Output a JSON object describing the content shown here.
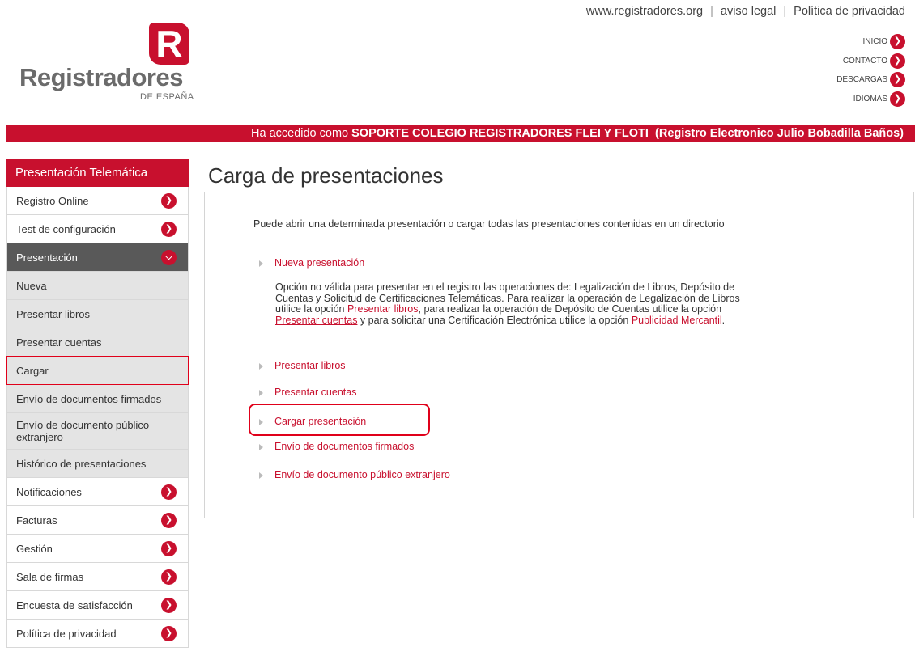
{
  "top_links": [
    "www.registradores.org",
    "aviso legal",
    "Política de privacidad"
  ],
  "logo": {
    "mark": "R",
    "name": "Registradores",
    "sub": "DE ESPAÑA"
  },
  "right_menu": [
    "INICIO",
    "CONTACTO",
    "DESCARGAS",
    "IDIOMAS"
  ],
  "login_bar": {
    "prefix": "Ha accedido como",
    "user": "SOPORTE COLEGIO REGISTRADORES FLEI Y FLOTI",
    "registry": "(Registro Electronico Julio Bobadilla Baños)"
  },
  "sidebar": {
    "header": "Presentación Telemática",
    "items": [
      {
        "label": "Registro Online"
      },
      {
        "label": "Test de configuración"
      },
      {
        "label": "Presentación"
      },
      {
        "label": "Nueva"
      },
      {
        "label": "Presentar libros"
      },
      {
        "label": "Presentar cuentas"
      },
      {
        "label": "Cargar"
      },
      {
        "label": "Envío de documentos firmados"
      },
      {
        "label": "Envío de documento público extranjero"
      },
      {
        "label": "Histórico de presentaciones"
      },
      {
        "label": "Notificaciones"
      },
      {
        "label": "Facturas"
      },
      {
        "label": "Gestión"
      },
      {
        "label": "Sala de firmas"
      },
      {
        "label": "Encuesta de satisfacción"
      },
      {
        "label": "Política de privacidad"
      }
    ]
  },
  "main": {
    "title": "Carga de presentaciones",
    "intro": "Puede abrir una determinada presentación o cargar todas las presentaciones contenidas en un directorio",
    "options": [
      {
        "label": "Nueva presentación"
      },
      {
        "label": "Presentar libros"
      },
      {
        "label": "Presentar cuentas"
      },
      {
        "label": "Cargar presentación"
      },
      {
        "label": "Envío de documentos firmados"
      },
      {
        "label": "Envío de documento público extranjero"
      }
    ],
    "description": {
      "part1": "Opción no válida para presentar en el registro las operaciones de: Legalización de Libros, Depósito de Cuentas y Solicitud de Certificaciones Telemáticas. Para realizar la operación de Legalización de Libros utilice la opción ",
      "link1": "Presentar libros",
      "part2": ", para realizar la operación de Depósito de Cuentas utilice la opción ",
      "link2": "Presentar cuentas",
      "part3": " y para solicitar una Certificación Electrónica utilice la opción ",
      "link3": "Publicidad Mercantil",
      "part4": "."
    }
  },
  "colors": {
    "brand": "#c8102e",
    "active_bg": "#595959",
    "sub_bg": "#e4e4e4"
  }
}
